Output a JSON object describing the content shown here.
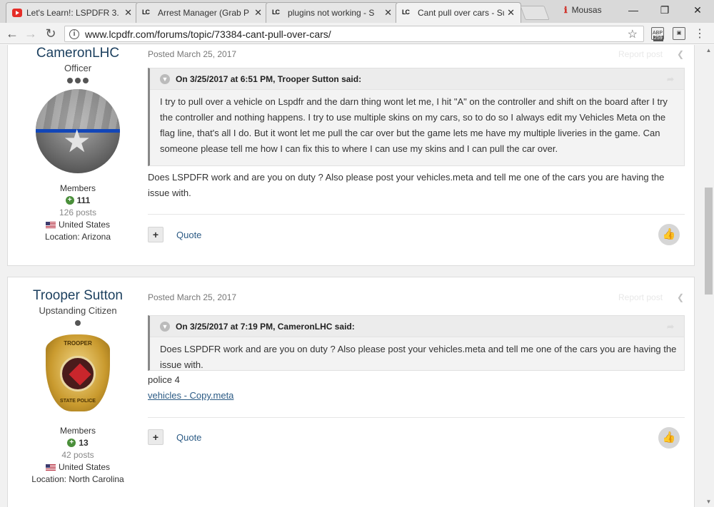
{
  "browser": {
    "tabs": [
      {
        "title": "Let's Learn!: LSPDFR 3.",
        "favicon": "youtube-icon"
      },
      {
        "title": "Arrest Manager (Grab P",
        "favicon": "lcpdfr-icon"
      },
      {
        "title": "plugins not working - S",
        "favicon": "lcpdfr-icon"
      },
      {
        "title": "Cant pull over cars - Su",
        "favicon": "lcpdfr-icon",
        "active": true
      }
    ],
    "profile_name": "Mousas",
    "url": "www.lcpdfr.com/forums/topic/73384-cant-pull-over-cars/",
    "ext_badge": "259",
    "ext_label": "ABP"
  },
  "posts": [
    {
      "author": "CameronLHC",
      "title": "Officer",
      "pips": 3,
      "group": "Members",
      "reputation": "111",
      "post_count": "126 posts",
      "country": "United States",
      "location": "Location: Arizona",
      "posted": "Posted March 25, 2017",
      "report": "Report post",
      "quote_header": "On 3/25/2017 at 6:51 PM, Trooper Sutton said:",
      "quote_body": "I try to pull over a vehicle on Lspdfr and the darn thing wont let me, I hit \"A\"  on the controller and shift on the board after I try the controller and nothing happens. I try to use multiple skins on my cars, so to do so I always edit my Vehicles Meta on the flag line, that's all I do. But it wont let me pull the car over but the game lets me have my multiple liveries in the game. Can someone please tell me how I can fix this to where I can use my skins and I can pull the car over.",
      "content": "Does LSPDFR work and are you on duty ? Also please post your vehicles.meta and tell me one of the cars you are having the issue with.",
      "quote_label": "Quote"
    },
    {
      "author": "Trooper Sutton",
      "title": "Upstanding Citizen",
      "pips": 1,
      "group": "Members",
      "reputation": "13",
      "post_count": "42 posts",
      "country": "United States",
      "location": "Location: North Carolina",
      "posted": "Posted March 25, 2017",
      "report": "Report post",
      "quote_header": "On 3/25/2017 at 7:19 PM, CameronLHC said:",
      "quote_body": "Does LSPDFR work and are you on duty ? Also please post your vehicles.meta and tell me one of the cars you are having the issue with.",
      "content": "police 4",
      "attachment": "vehicles - Copy.meta",
      "quote_label": "Quote",
      "badge_top": "TROOPER",
      "badge_bottom": "STATE POLICE"
    }
  ]
}
